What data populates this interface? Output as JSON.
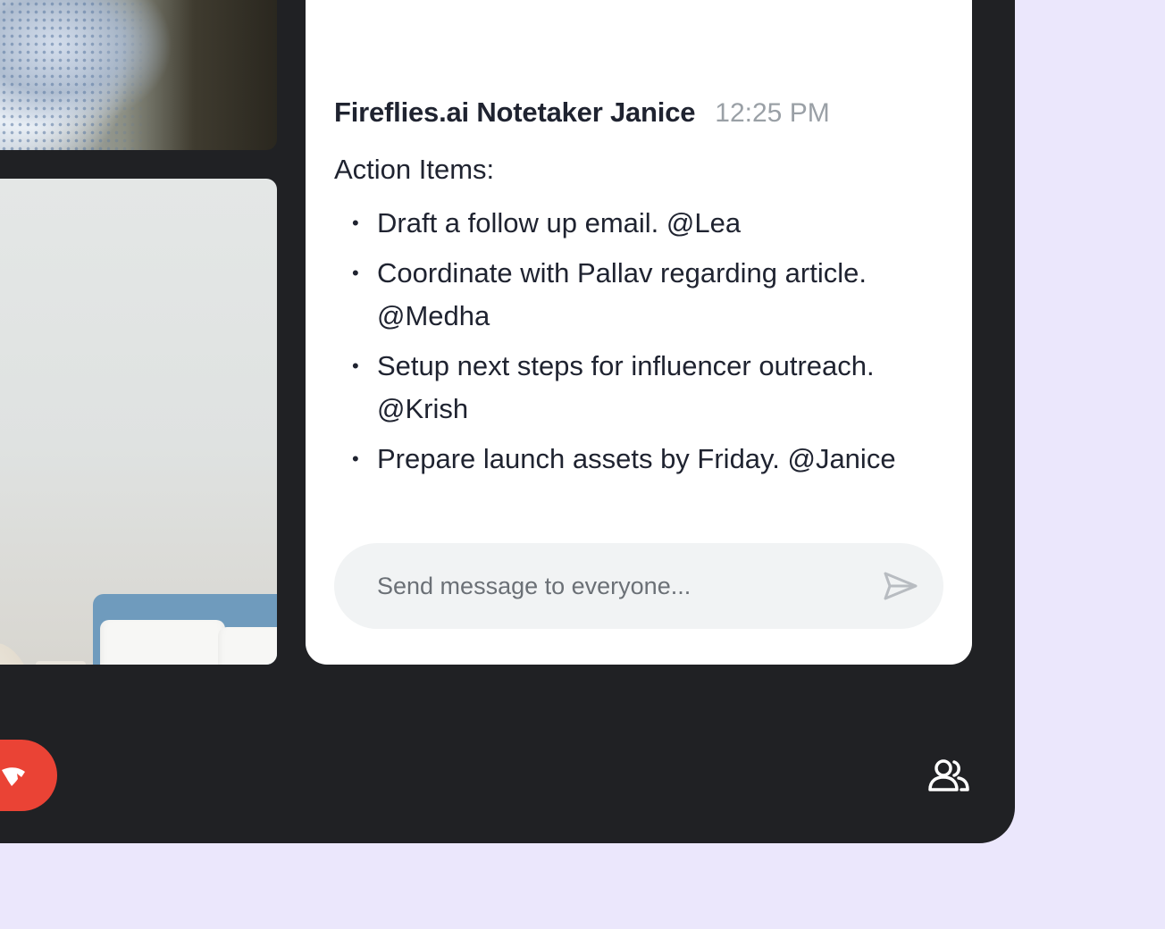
{
  "chat": {
    "sender": "Fireflies.ai Notetaker Janice",
    "time": "12:25 PM",
    "heading": "Action Items:",
    "items": [
      "Draft a follow up email. @Lea",
      "Coordinate with Pallav regarding article. @Medha",
      "Setup next steps for influencer outreach. @Krish",
      "Prepare launch assets by Friday. @Janice"
    ],
    "bullet": "•"
  },
  "composer": {
    "placeholder": "Send message to everyone...",
    "send_icon": "send-icon"
  },
  "controls": {
    "end_call_icon": "phone-hangup-icon",
    "people_icon": "people-icon"
  },
  "colors": {
    "background": "#ebe7fc",
    "window": "#202124",
    "end_call": "#ea4335",
    "timestamp": "#9aa0a6"
  }
}
